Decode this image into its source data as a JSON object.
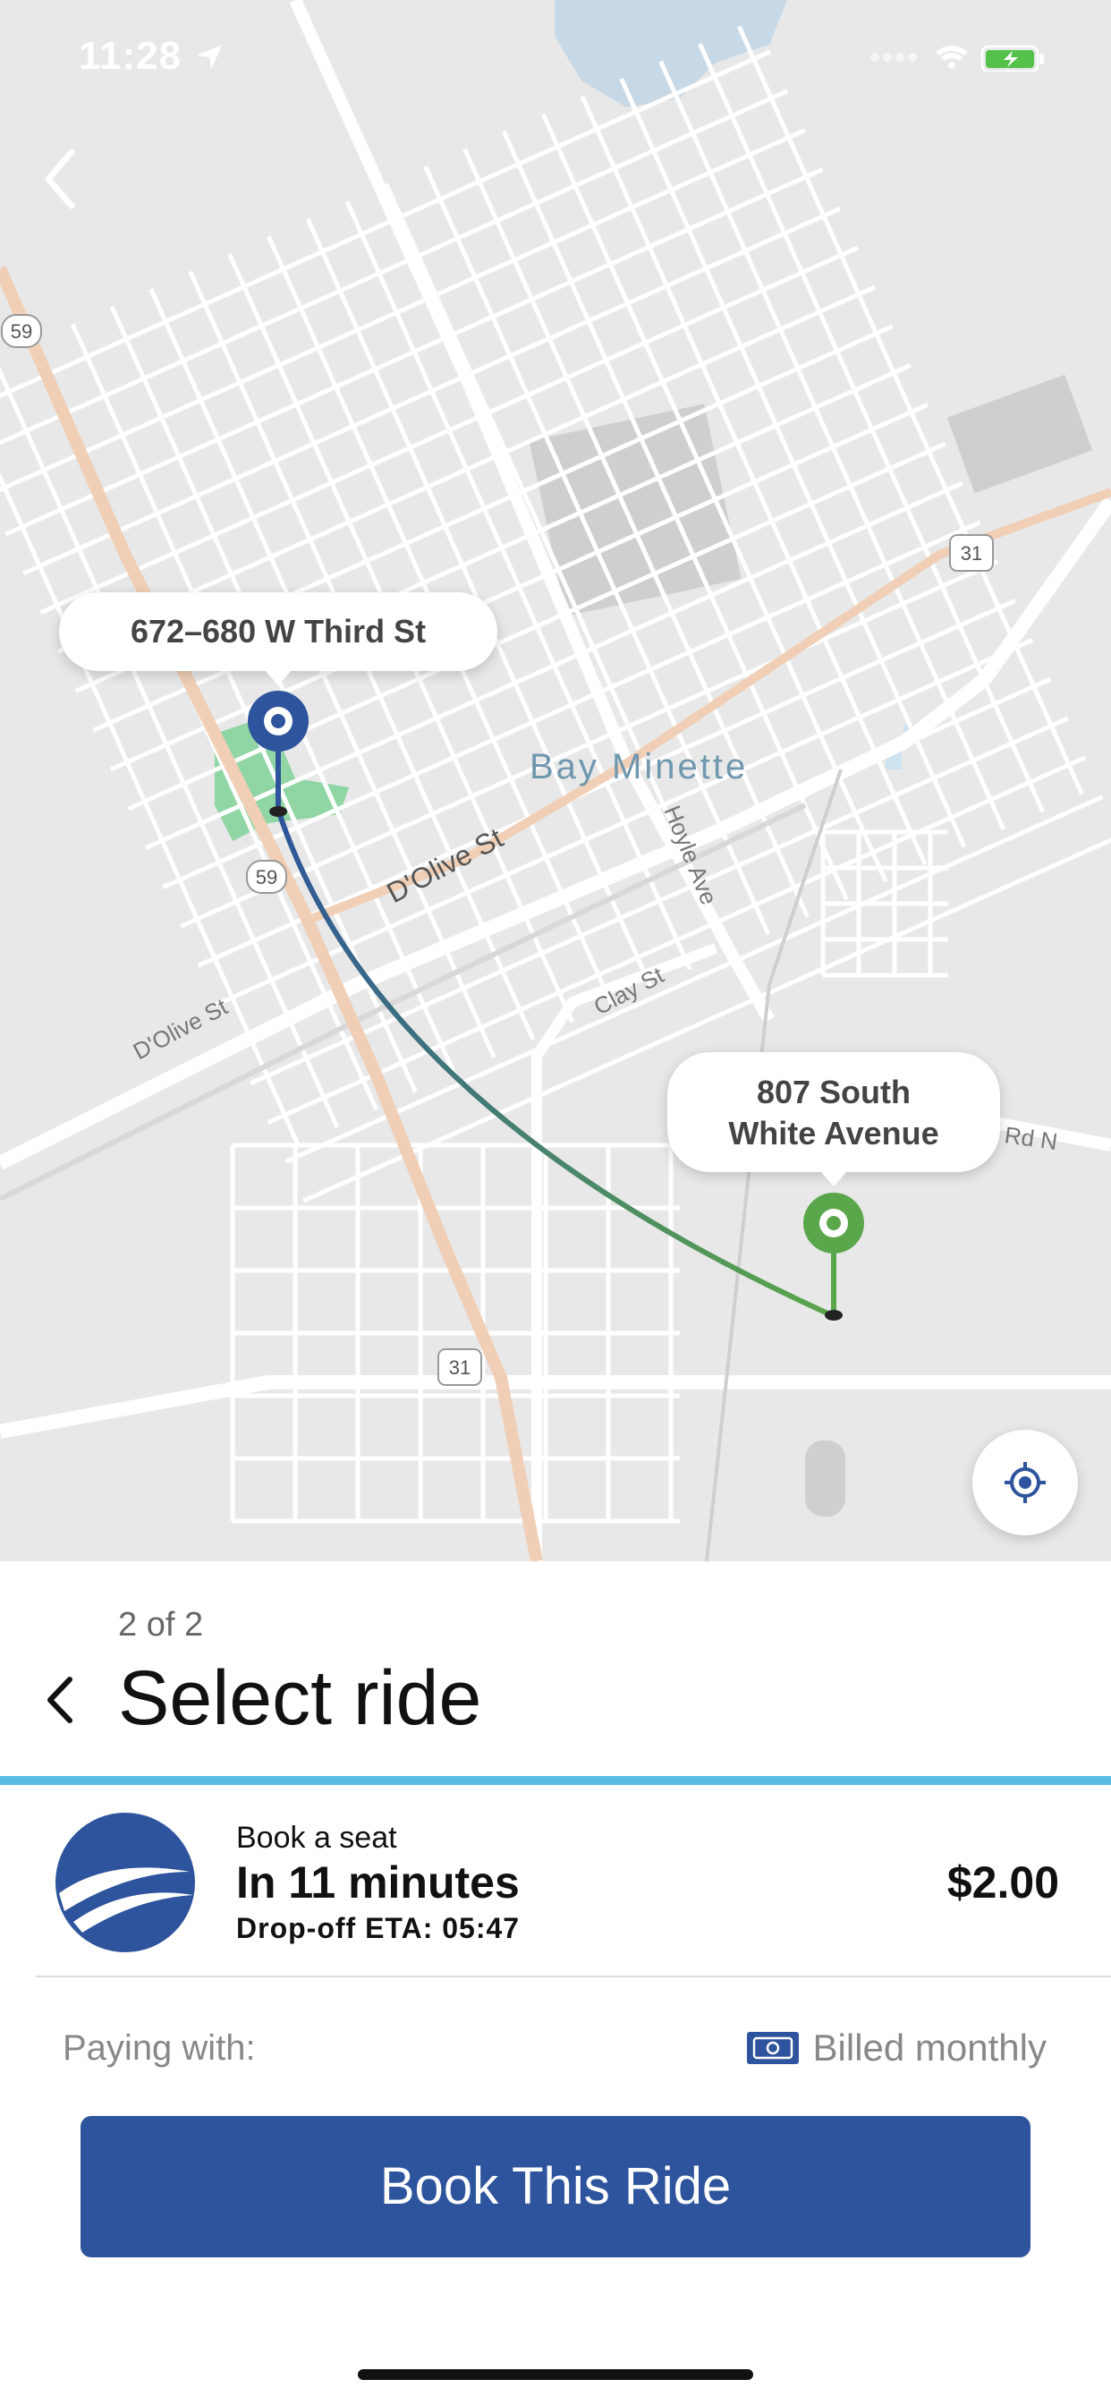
{
  "status_bar": {
    "time": "11:28"
  },
  "map": {
    "pickup_label": "672–680 W Third St",
    "dropoff_label_line1": "807 South",
    "dropoff_label_line2": "White Avenue",
    "town_label": "Bay Minette",
    "streets": [
      "D'Olive St",
      "D'Olive St",
      "Hoyle Ave",
      "Clay St",
      "Rd N"
    ],
    "shields": [
      "59",
      "59",
      "31",
      "31"
    ],
    "colors": {
      "pickup": "#2d549c",
      "dropoff": "#5aa64a",
      "route_start": "#2d549c",
      "route_end": "#5aa64a"
    }
  },
  "panel": {
    "step": "2 of 2",
    "title": "Select ride",
    "ride": {
      "type": "Book a seat",
      "time": "In 11 minutes",
      "eta": "Drop-off ETA: 05:47",
      "price": "$2.00"
    },
    "paying_label": "Paying with:",
    "payment_method": "Billed monthly",
    "book_button": "Book This Ride"
  },
  "icons": [
    "location-arrow-icon",
    "signal-icon",
    "wifi-icon",
    "battery-icon",
    "back-chevron-icon",
    "locate-icon",
    "cash-icon"
  ]
}
